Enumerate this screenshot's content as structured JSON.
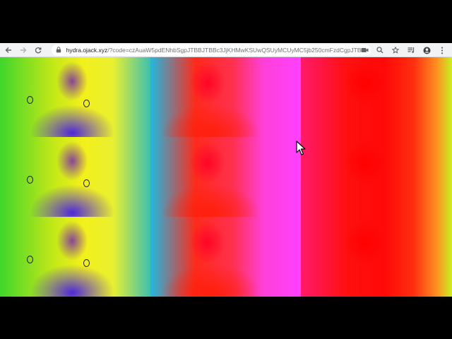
{
  "browser": {
    "nav": {
      "back_icon": "arrow-left-icon",
      "forward_icon": "arrow-right-icon",
      "reload_icon": "reload-icon"
    },
    "omnibox": {
      "host": "hydra.ojack.xyz",
      "path": "/?code=czAuaW5pdENhbSgpJTBBJTBBc3JjKHMwKSUwQSUyMCUyMC5jb250cmFzdCgpJTBBJTIi..."
    },
    "right_icons": [
      "camera-icon",
      "zoom-icon",
      "bookmark-star-icon",
      "media-queue-icon",
      "profile-icon",
      "kebab-menu-icon"
    ]
  },
  "visualization": {
    "grid": {
      "rows": 3,
      "columns": 3
    },
    "palette": {
      "column_1": [
        "#3fd62b",
        "#f3f01a",
        "#4620e6"
      ],
      "column_2": [
        "#22b8e0",
        "#ff2a1a",
        "#ff40ff"
      ],
      "column_3": [
        "#ff1a6a",
        "#ff0808",
        "#ff9020"
      ]
    }
  },
  "cursor": {
    "icon": "mouse-pointer-icon"
  }
}
